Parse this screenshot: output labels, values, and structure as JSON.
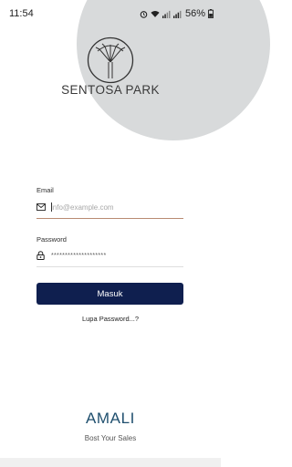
{
  "status_bar": {
    "time": "11:54",
    "battery_percent": "56%"
  },
  "brand": {
    "logo_icon": "tree-icon",
    "name": "SENTOSA PARK"
  },
  "login": {
    "email_label": "Email",
    "email_placeholder": "info@example.com",
    "email_icon": "mail-icon",
    "password_label": "Password",
    "password_value": "********************",
    "password_icon": "lock-icon",
    "submit_label": "Masuk",
    "forgot_label": "Lupa Password...?"
  },
  "footer": {
    "title": "AMALI",
    "tagline": "Bost Your Sales"
  },
  "colors": {
    "primary_button": "#0f1f4f",
    "accent_text": "#1f4f6e",
    "circle_bg": "#d8dadb"
  }
}
